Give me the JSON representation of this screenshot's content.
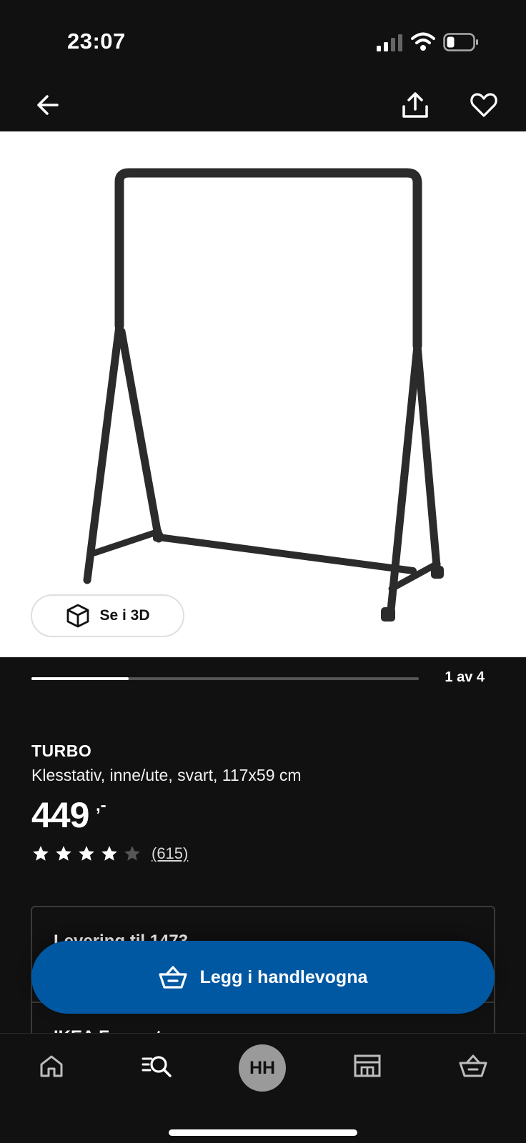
{
  "status_bar": {
    "time": "23:07"
  },
  "nav": {
    "back_icon": "arrow-left-icon",
    "share_icon": "share-icon",
    "favorite_icon": "heart-icon"
  },
  "gallery": {
    "view_3d_label": "Se i 3D",
    "current": 1,
    "total": 4,
    "counter_label": "1 av 4"
  },
  "product": {
    "name": "TURBO",
    "description": "Klesstativ, inne/ute, svart, 117x59 cm",
    "price": "449",
    "price_suffix": ",-",
    "rating": 4,
    "rating_max": 5,
    "review_count": "(615)"
  },
  "delivery": {
    "title": "Levering til 1473",
    "store": "IKEA Furuset"
  },
  "cart_button": {
    "label": "Legg i handlevogna",
    "icon": "basket-icon"
  },
  "bottom_nav": {
    "items": [
      "home-icon",
      "search-icon",
      "profile-avatar",
      "store-icon",
      "basket-icon"
    ],
    "avatar_initials": "HH"
  },
  "colors": {
    "background": "#111111",
    "primary_button": "#0058a3",
    "image_bg": "#ffffff"
  }
}
